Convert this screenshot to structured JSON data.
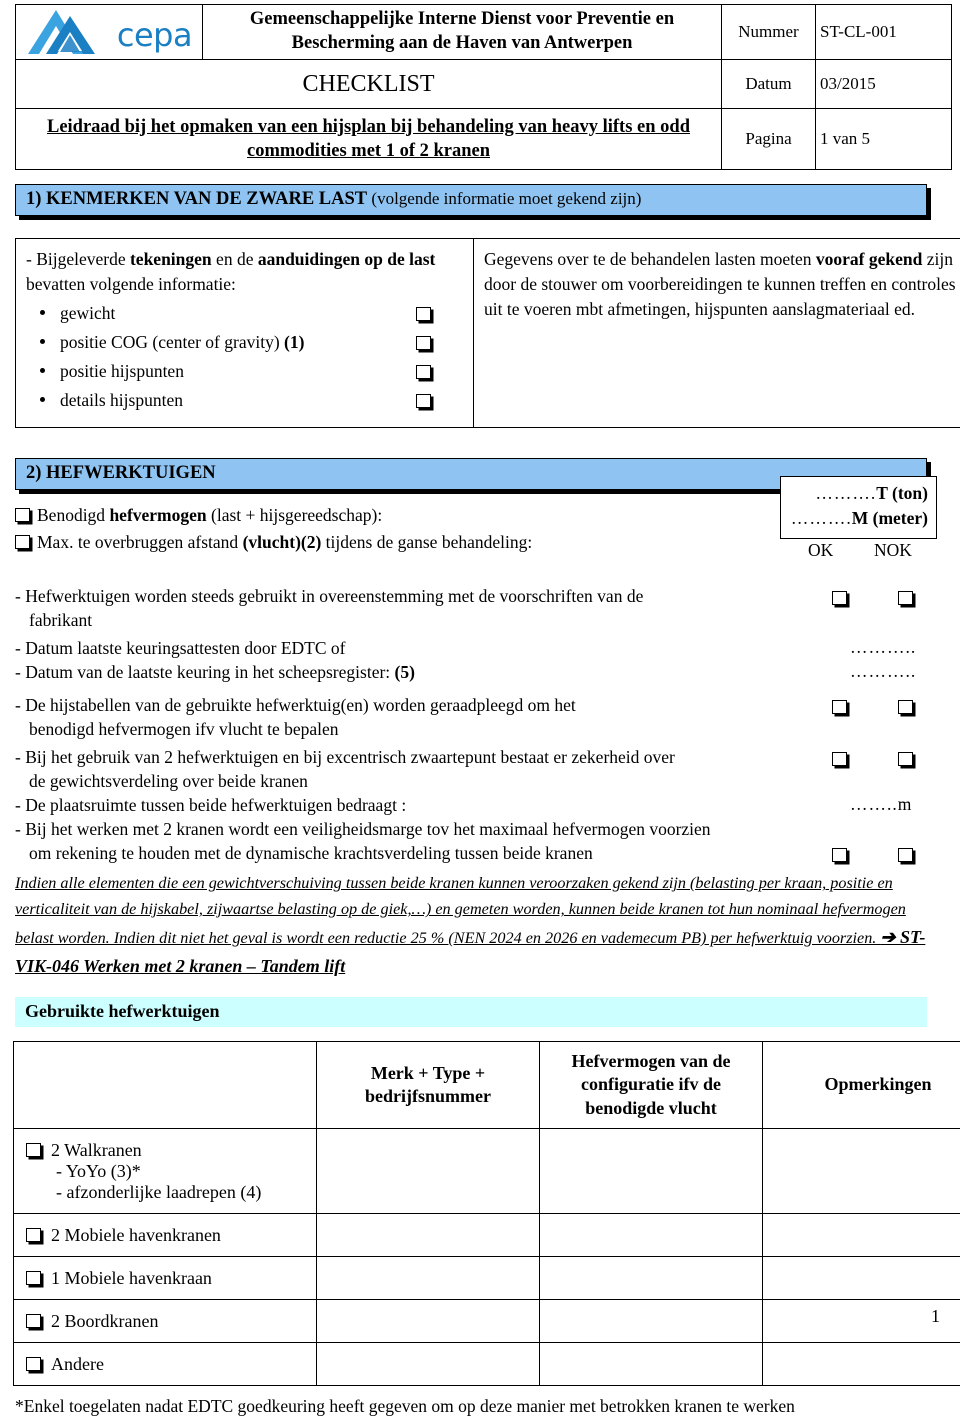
{
  "header": {
    "logo_alt": "cepa-logo",
    "logo_text": "cepa",
    "organisation": "Gemeenschappelijke Interne Dienst voor Preventie en Bescherming aan de Haven van Antwerpen",
    "doc_type": "CHECKLIST",
    "doc_subtitle": "Leidraad bij het opmaken van een hijsplan bij behandeling van heavy lifts en odd commodities met 1 of 2 kranen",
    "meta": [
      {
        "label": "Nummer",
        "value": "ST-CL-001"
      },
      {
        "label": "Datum",
        "value": "03/2015"
      },
      {
        "label": "Pagina",
        "value": "1 van 5"
      }
    ]
  },
  "section1": {
    "heading_num": "1) KENMERKEN VAN DE  ZWARE LAST ",
    "heading_paren": "(volgende informatie moet gekend zijn)",
    "left": {
      "intro_pre": "- Bijgeleverde ",
      "intro_b1": "tekeningen",
      "intro_mid": " en de ",
      "intro_b2": "aanduidingen op de last",
      "intro_post": " bevatten volgende informatie:",
      "items": [
        {
          "label": "gewicht",
          "suffix": ""
        },
        {
          "label": "positie COG (center of gravity) ",
          "suffix": "(1)"
        },
        {
          "label": "positie hijspunten",
          "suffix": ""
        },
        {
          "label": "details hijspunten",
          "suffix": ""
        }
      ]
    },
    "right": {
      "pre": "Gegevens over te de behandelen lasten moeten ",
      "bold": "vooraf gekend",
      "post": " zijn door de stouwer om voorbereidingen te kunnen treffen en controles uit te voeren mbt afmetingen, hijspunten aanslagmateriaal ed."
    }
  },
  "section2": {
    "heading": "2) HEFWERKTUIGEN",
    "lines": [
      {
        "pre": "Benodigd ",
        "bold": "hefvermogen",
        "post": " (last + hijsgereedschap):"
      },
      {
        "pre": "Max. te overbruggen afstand ",
        "bold": "(vlucht)(2)",
        "post": "  tijdens de ganse behandeling:"
      }
    ],
    "value_box": [
      {
        "dots": "……….",
        "unit": "T (ton)"
      },
      {
        "dots": "……….",
        "unit": "M (meter)"
      }
    ],
    "ok_label": "OK",
    "nok_label": "NOK",
    "rows": [
      {
        "text": "- Hefwerktuigen worden steeds gebruikt in overeenstemming met de voorschriften van de",
        "text2": "fabrikant",
        "mark": "boxes"
      },
      {
        "text": "- Datum laatste keuringsattesten  door EDTC of",
        "text2": "",
        "mark": "dots",
        "fill": "……….."
      },
      {
        "text": "- Datum van de laatste keuring in het scheepsregister: ",
        "bold": "(5)",
        "text2": "",
        "mark": "dots",
        "fill": "……….."
      },
      {
        "text": "- De hijstabellen van de gebruikte hefwerktuig(en) worden geraadpleegd om het",
        "text2": "benodigd hefvermogen ifv vlucht te bepalen",
        "mark": "boxes"
      },
      {
        "text": "- Bij het gebruik van 2 hefwerktuigen en bij excentrisch zwaartepunt bestaat er zekerheid over",
        "text2": "de gewichtsverdeling over beide kranen",
        "mark": "boxes"
      },
      {
        "text": "- De plaatsruimte tussen beide hefwerktuigen bedraagt :",
        "text2": "",
        "mark": "dots",
        "fill": "……..m"
      },
      {
        "text": "- Bij het werken met 2 kranen wordt een veiligheidsmarge tov het maximaal hefvermogen voorzien",
        "text2": "om rekening te houden met de dynamische krachtsverdeling tussen beide kranen",
        "mark": "boxes-bottom"
      }
    ],
    "italic_note": "Indien alle elementen die een gewichtverschuiving tussen beide kranen kunnen veroorzaken gekend zijn (belasting per kraan, positie en verticaliteit van de hijskabel, zijwaartse belasting op de giek,…) en gemeten worden, kunnen beide kranen tot hun nominaal hefvermogen belast worden. Indien dit niet het geval is wordt een reductie 25 % (NEN 2024 en 2026 en vademecum PB) per hefwerktuig voorzien. ",
    "italic_ref": "➔ ST-VIK-046 Werken met 2 kranen – Tandem lift"
  },
  "equipment": {
    "banner": "Gebruikte hefwerktuigen",
    "columns": [
      "",
      "Merk + Type + bedrijfsnummer",
      "Hefvermogen van de configuratie ifv de benodigde vlucht",
      "Opmerkingen"
    ],
    "rows": [
      {
        "label": "2 Walkranen",
        "subs": [
          "- YoYo (3)*",
          "- afzonderlijke laadrepen (4)"
        ],
        "merk": "",
        "hefvermogen": "",
        "opmerkingen": ""
      },
      {
        "label": "2 Mobiele havenkranen",
        "subs": [],
        "merk": "",
        "hefvermogen": "",
        "opmerkingen": ""
      },
      {
        "label": "1 Mobiele havenkraan",
        "subs": [],
        "merk": "",
        "hefvermogen": "",
        "opmerkingen": ""
      },
      {
        "label": "2 Boordkranen",
        "subs": [],
        "merk": "",
        "hefvermogen": "",
        "opmerkingen": ""
      },
      {
        "label": "Andere",
        "subs": [],
        "merk": "",
        "hefvermogen": "",
        "opmerkingen": ""
      }
    ]
  },
  "footer": {
    "note": "*Enkel toegelaten nadat EDTC goedkeuring heeft gegeven om op deze manier met betrokken kranen te werken",
    "page_number": "1"
  },
  "colors": {
    "section_blue": "#8fc4f2",
    "banner_cyan": "#ccffff",
    "logo_blue_dark": "#1b7fc4",
    "logo_blue_light": "#3aa3e0"
  }
}
